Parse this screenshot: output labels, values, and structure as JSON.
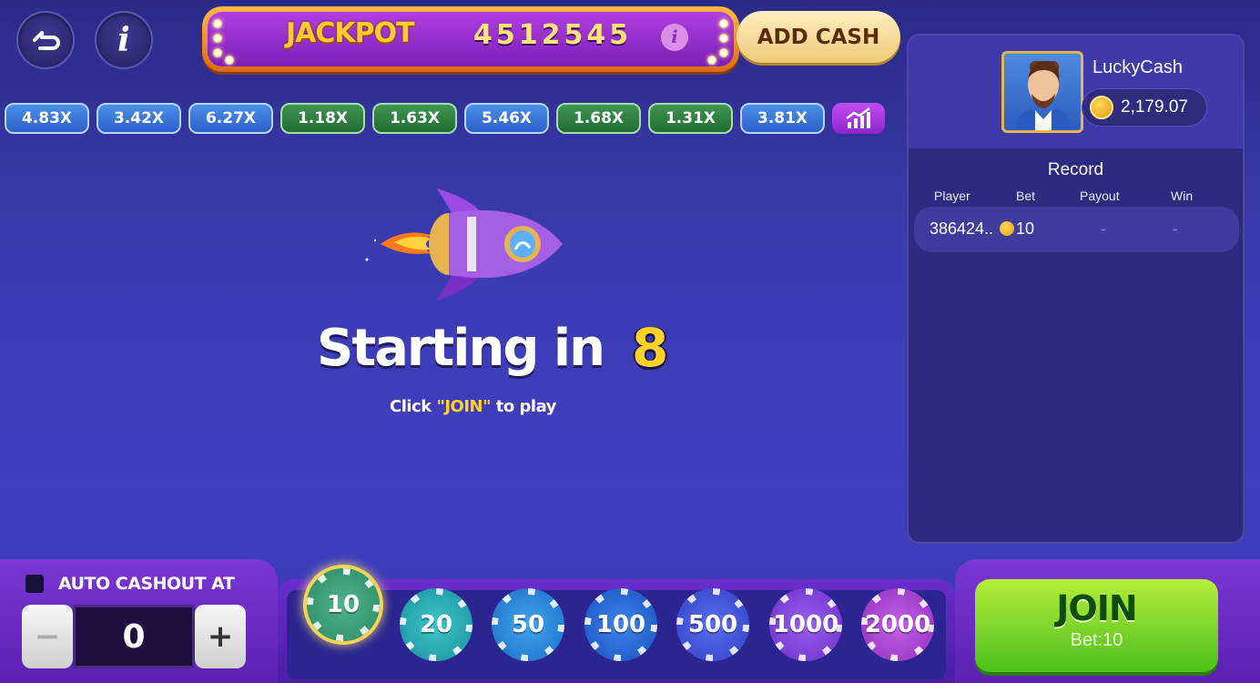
{
  "header": {
    "jackpot_label": "JACKPOT",
    "jackpot_value": "4512545",
    "add_cash_label": "ADD CASH"
  },
  "multipliers": [
    {
      "label": "4.83X",
      "color": "blue"
    },
    {
      "label": "3.42X",
      "color": "blue"
    },
    {
      "label": "6.27X",
      "color": "blue"
    },
    {
      "label": "1.18X",
      "color": "green"
    },
    {
      "label": "1.63X",
      "color": "green"
    },
    {
      "label": "5.46X",
      "color": "blue"
    },
    {
      "label": "1.68X",
      "color": "green"
    },
    {
      "label": "1.31X",
      "color": "green"
    },
    {
      "label": "3.81X",
      "color": "blue"
    }
  ],
  "game": {
    "starting_text": "Starting in",
    "countdown": "8",
    "hint_prefix": "Click",
    "hint_join": "\"JOIN\"",
    "hint_suffix": "to play"
  },
  "player": {
    "name": "LuckyCash",
    "balance": "2,179.07"
  },
  "record": {
    "title": "Record",
    "columns": [
      "Player",
      "Bet",
      "Payout",
      "Win"
    ],
    "rows": [
      {
        "player": "386424..",
        "bet": "10",
        "payout": "-",
        "win": "-"
      }
    ]
  },
  "auto_cashout": {
    "label": "AUTO CASHOUT AT",
    "value": "0",
    "minus": "−",
    "plus": "+"
  },
  "chips": [
    {
      "value": "10",
      "selected": true
    },
    {
      "value": "20",
      "selected": false
    },
    {
      "value": "50",
      "selected": false
    },
    {
      "value": "100",
      "selected": false
    },
    {
      "value": "500",
      "selected": false
    },
    {
      "value": "1000",
      "selected": false
    },
    {
      "value": "2000",
      "selected": false
    }
  ],
  "join": {
    "label": "JOIN",
    "bet_label": "Bet:10"
  },
  "colors": {
    "accent_yellow": "#ffd22a",
    "join_green": "#4bbf1c",
    "mult_blue": "#2d61c9",
    "mult_green": "#236b34"
  }
}
